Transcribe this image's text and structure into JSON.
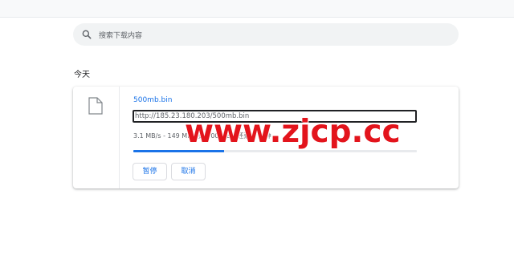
{
  "search": {
    "placeholder": "搜索下载内容",
    "icon": "search-icon"
  },
  "section": {
    "title": "今天"
  },
  "download": {
    "file_name": "500mb.bin",
    "url": "http://185.23.180.203/500mb.bin",
    "status": "3.1 MB/s - 149 MB，共 500 MB，还剩 2 分钟",
    "progress": 0.32,
    "pause_label": "暂停",
    "cancel_label": "取消"
  },
  "watermark": {
    "text": "www.zjcp.cc"
  },
  "colors": {
    "accent": "#1a73e8",
    "watermark": "#e3141c"
  }
}
